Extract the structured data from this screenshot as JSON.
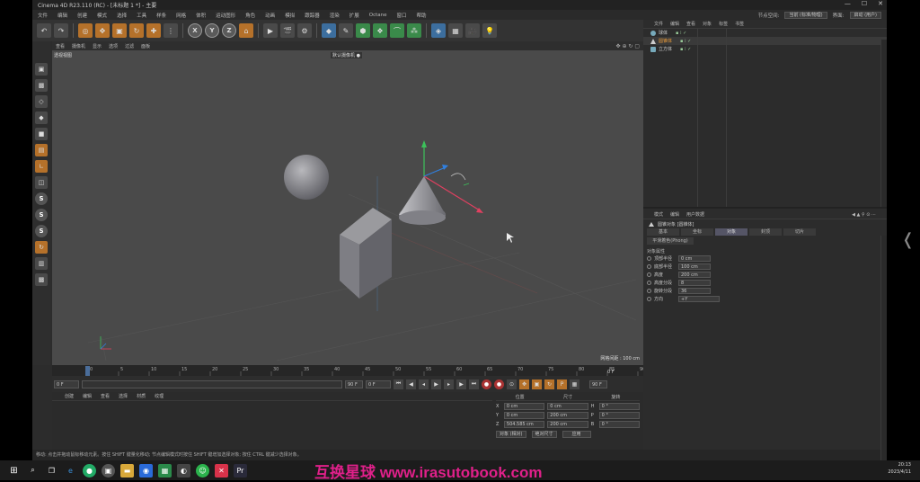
{
  "window": {
    "title": "Cinema 4D R23.110 (RC) - [未标题 1 *] - 主要",
    "controls": [
      "—",
      "☐",
      "✕"
    ]
  },
  "menubar": {
    "items": [
      "文件",
      "编辑",
      "创建",
      "模式",
      "选择",
      "工具",
      "样条",
      "网格",
      "体积",
      "运动图形",
      "角色",
      "动画",
      "模拟",
      "跟踪器",
      "渲染",
      "扩展",
      "Octane",
      "窗口",
      "帮助"
    ],
    "layout_label": "界面:",
    "layout_value": "启动 (用户)",
    "node_label": "节点空间:",
    "node_value": "当前 (标准/物理)"
  },
  "toolbar": {
    "undo": "↶",
    "redo": "↷",
    "x": "X",
    "y": "Y",
    "z": "Z"
  },
  "viewport": {
    "menu": [
      "查看",
      "摄像机",
      "显示",
      "选项",
      "过滤",
      "面板"
    ],
    "label": "透视视图",
    "camera": "默认摄像机 ●",
    "grid_scale": "网格间距 : 100 cm"
  },
  "timeline": {
    "ticks": [
      "0",
      "5",
      "10",
      "15",
      "20",
      "25",
      "30",
      "35",
      "40",
      "45",
      "50",
      "55",
      "60",
      "65",
      "70",
      "75",
      "80",
      "85",
      "90"
    ],
    "end_frame": "0 F",
    "start_field": "0 F",
    "current_field": "0 F",
    "end_field": "90 F",
    "end_field2": "90 F"
  },
  "material_panel": {
    "tabs": [
      "创建",
      "编辑",
      "查看",
      "选择",
      "材质",
      "纹理"
    ]
  },
  "coordinates": {
    "headers": [
      "位置",
      "尺寸",
      "旋转"
    ],
    "rows": [
      {
        "axis": "X",
        "pos": "0 cm",
        "size": "0 cm",
        "rot_label": "H",
        "rot": "0 °"
      },
      {
        "axis": "Y",
        "pos": "0 cm",
        "size": "200 cm",
        "rot_label": "P",
        "rot": "0 °"
      },
      {
        "axis": "Z",
        "pos": "504.585 cm",
        "size": "200 cm",
        "rot_label": "B",
        "rot": "0 °"
      }
    ],
    "mode": "对象 (相对)",
    "size_mode": "绝对尺寸",
    "apply": "应用"
  },
  "status": {
    "text": "移动: 点击并拖动鼠标移动元素。按住 SHIFT 键量化移动; 节点编辑模式时按住 SHIFT 键增加选择对象; 按住 CTRL 键减少选择对象。"
  },
  "objects": {
    "tabs": [
      "文件",
      "编辑",
      "查看",
      "对象",
      "标签",
      "书签"
    ],
    "items": [
      {
        "name": "球体",
        "type": "sphere"
      },
      {
        "name": "圆锥体",
        "type": "cone"
      },
      {
        "name": "立方体",
        "type": "cube"
      }
    ]
  },
  "attributes": {
    "tabs": [
      "模式",
      "编辑",
      "用户数据"
    ],
    "title": "圆锥对象 [圆锥体]",
    "subtabs": [
      "基本",
      "坐标",
      "对象",
      "封顶",
      "切片"
    ],
    "active_subtab": 2,
    "phong_label": "平滑着色(Phong)",
    "section": "对象属性",
    "props": [
      {
        "name": "顶部半径",
        "value": "0 cm"
      },
      {
        "name": "底部半径",
        "value": "100 cm"
      },
      {
        "name": "高度",
        "value": "200 cm"
      },
      {
        "name": "高度分段",
        "value": "8"
      },
      {
        "name": "旋转分段",
        "value": "36"
      },
      {
        "name": "方向",
        "value": "+Y"
      }
    ]
  },
  "taskbar": {
    "watermark": "互换星球 www.irasutobook.com",
    "time": "20:13",
    "date": "2023/4/11"
  },
  "colors": {
    "accent": "#b5712a",
    "watermark": "#e0208a"
  }
}
